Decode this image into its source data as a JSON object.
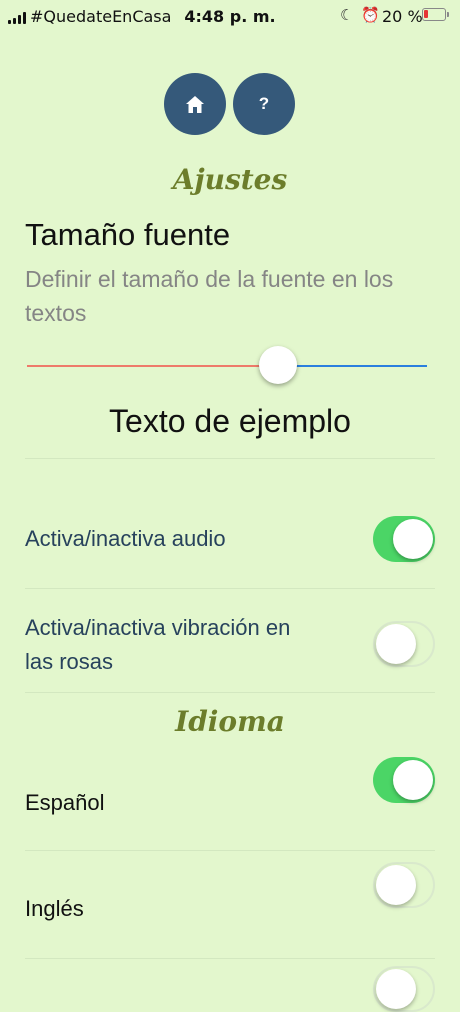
{
  "status_bar": {
    "carrier": "#QuedateEnCasa",
    "time": "4:48 p. m.",
    "battery": "20 %",
    "icons": [
      "signal-icon",
      "moon-icon",
      "alarm-icon",
      "battery-icon"
    ],
    "battery_color": "#e53535"
  },
  "top_buttons": {
    "home_icon": "home-icon",
    "help_label": "?"
  },
  "settings": {
    "title": "Ajustes",
    "font_size": {
      "title": "Tamaño fuente",
      "description": "Definir el tamaño de la fuente en los textos",
      "slider_value": 0.63,
      "sample_text": "Texto de ejemplo"
    },
    "toggles": [
      {
        "label": "Activa/inactiva audio",
        "on": true
      },
      {
        "label": "Activa/inactiva vibración en las rosas",
        "on": false
      }
    ]
  },
  "language": {
    "title": "Idioma",
    "options": [
      {
        "label": "Español",
        "on": true
      },
      {
        "label": "Inglés",
        "on": false
      },
      {
        "label": "",
        "on": false
      }
    ]
  },
  "colors": {
    "background": "#e3f7cd",
    "button_blue": "#35597a",
    "title_olive": "#6c7d2b",
    "toggle_on": "#4bd566",
    "slider_left": "#ee7a6a",
    "slider_right": "#2b7fde"
  }
}
